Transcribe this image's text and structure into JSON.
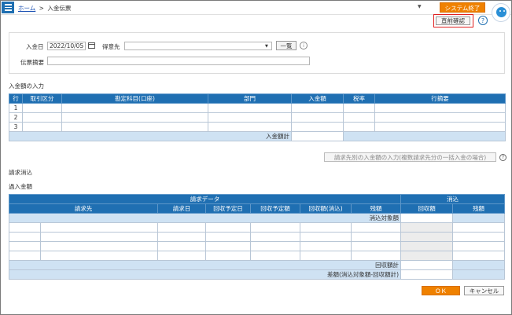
{
  "header": {
    "menu_icon": "hamburger-icon",
    "breadcrumb_home": "ホーム",
    "breadcrumb_sep": ">",
    "breadcrumb_current": "入金伝票",
    "system_exit": "システム終了",
    "avatar_icon": "assistant-avatar-icon"
  },
  "toolbar": {
    "prev_confirm": "直前確認",
    "help": "?"
  },
  "form": {
    "date_label": "入金日",
    "date_value": "2022/10/05",
    "customer_label": "得意先",
    "customer_value": "",
    "list_button": "一覧",
    "info": "i",
    "memo_label": "伝票摘要",
    "memo_value": ""
  },
  "deposit": {
    "title": "入金額の入力",
    "columns": [
      "行",
      "取引区分",
      "勘定科目(口座)",
      "部門",
      "入金額",
      "税率",
      "行摘要"
    ],
    "rows": [
      "1",
      "2",
      "3"
    ],
    "total_label": "入金額計",
    "multi_button": "請求先別の入金額の入力(複数請求先分の一括入金の場合)",
    "help": "?"
  },
  "settlement": {
    "title": "請求消込",
    "over_label": "過入金額",
    "group_request": "請求データ",
    "group_clear": "消込",
    "columns": [
      "請求先",
      "請求日",
      "回収予定日",
      "回収予定額",
      "回収額(消込)",
      "残額",
      "回収額",
      "残額"
    ],
    "target_label": "消込対象額",
    "collected_total": "回収額計",
    "diff_label": "差額(消込対象額-回収額計)"
  },
  "footer": {
    "ok": "ＯＫ",
    "cancel": "キャンセル"
  }
}
